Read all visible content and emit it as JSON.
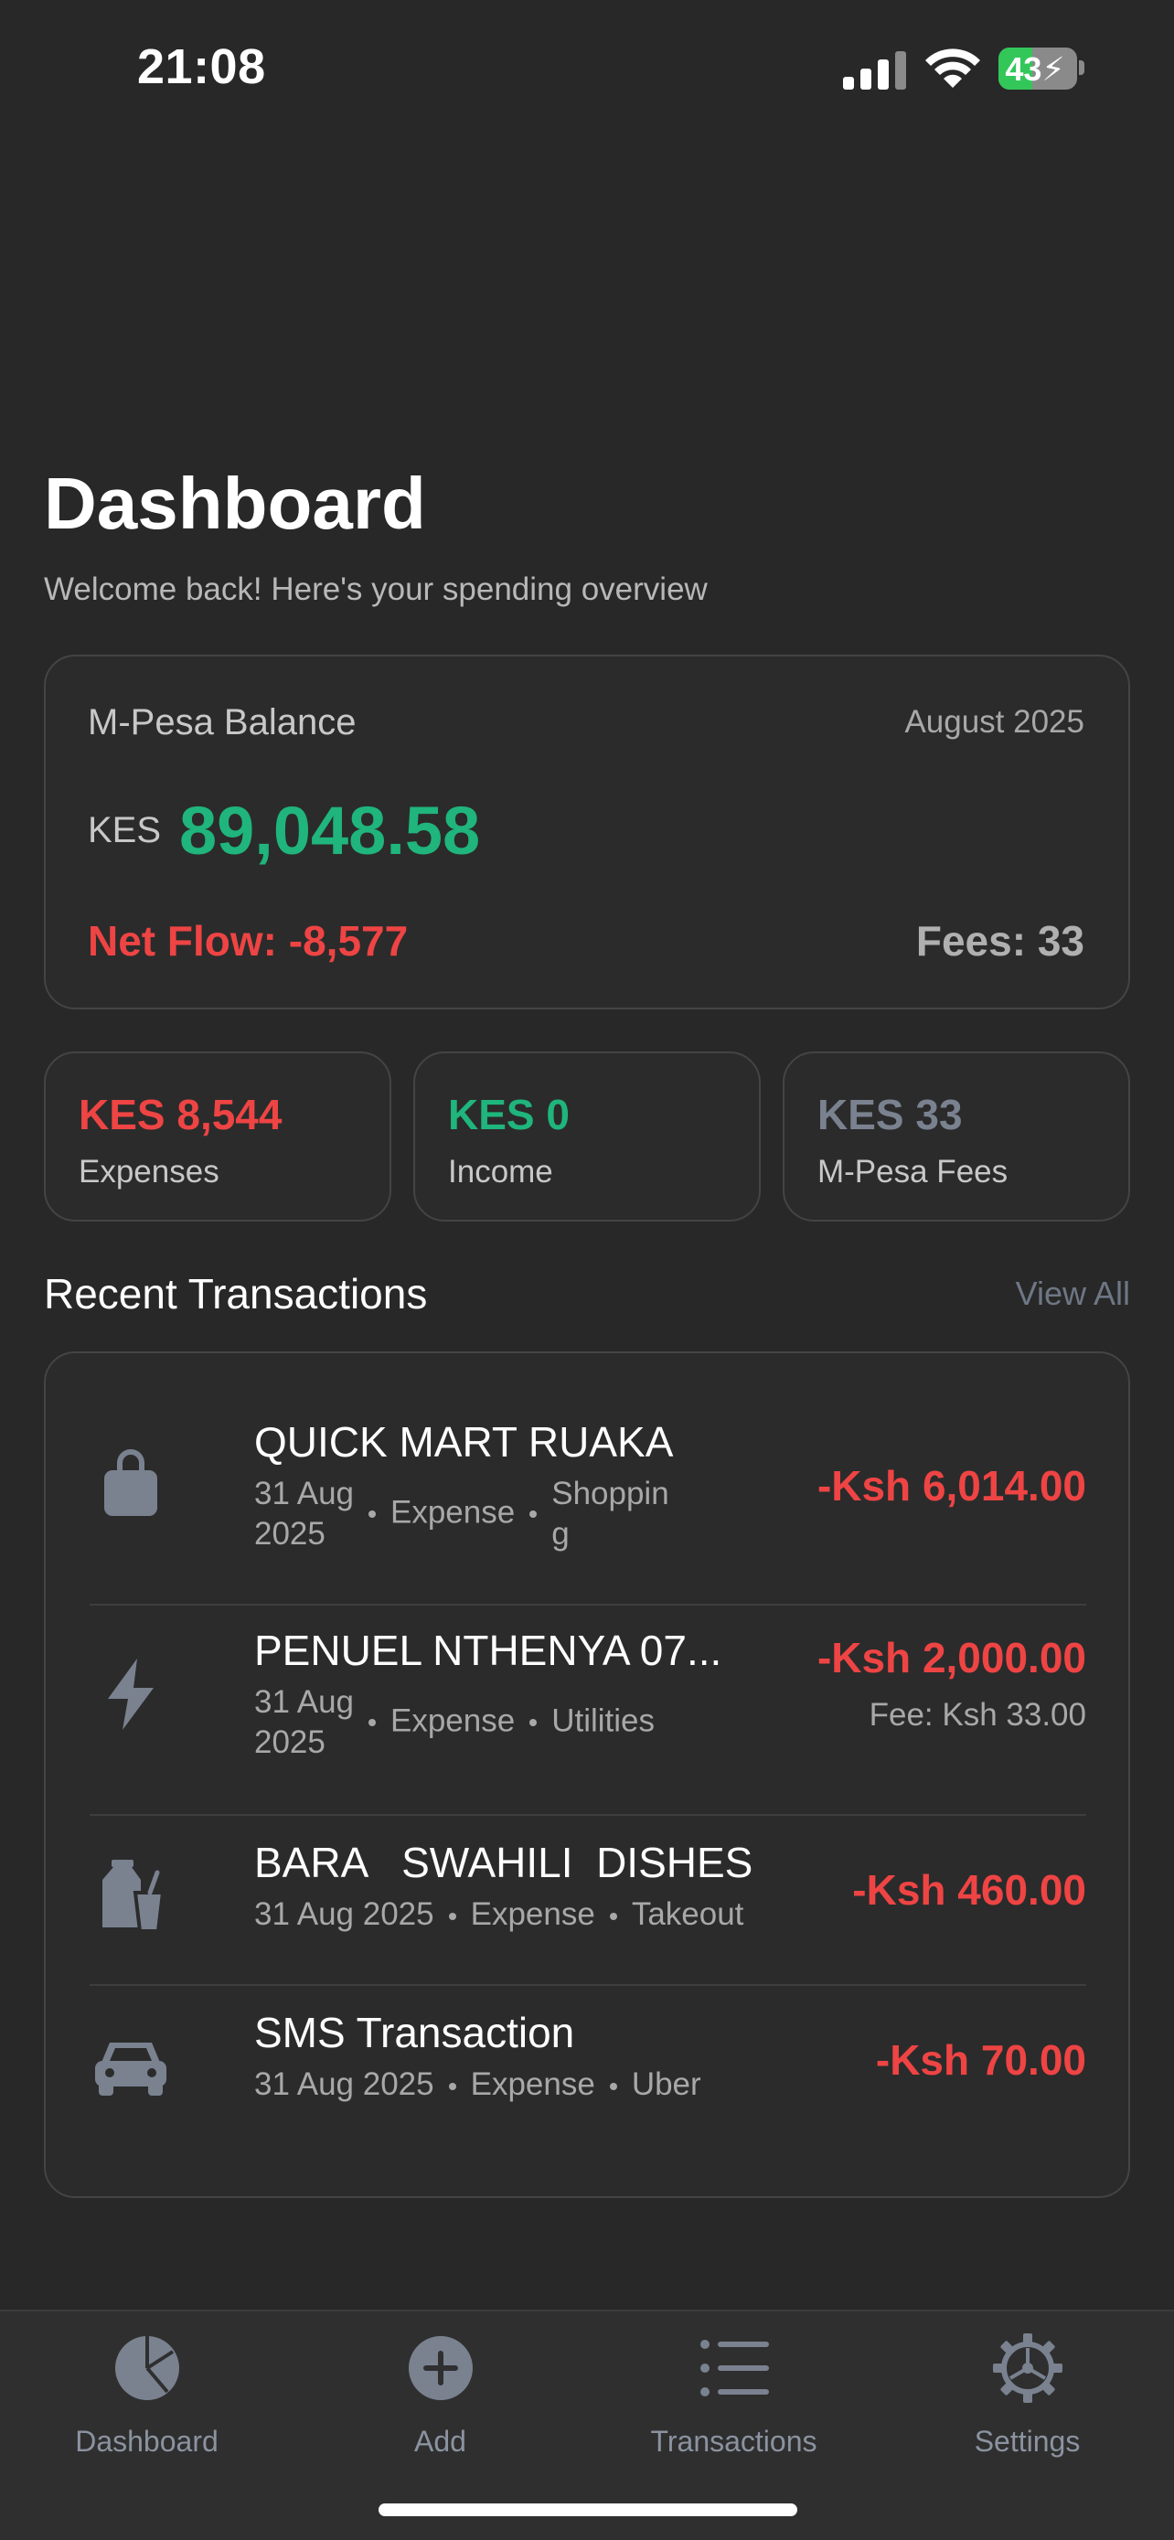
{
  "status_bar": {
    "time": "21:08",
    "battery": "43",
    "icons": [
      "signal-icon",
      "wifi-icon",
      "battery-charging-icon"
    ]
  },
  "header": {
    "title": "Dashboard",
    "subtitle": "Welcome back! Here's your spending overview"
  },
  "balance_card": {
    "label": "M-Pesa Balance",
    "period": "August 2025",
    "currency": "KES",
    "amount": "89,048.58",
    "net_flow": "Net Flow: -8,577",
    "fees": "Fees: 33",
    "colors": {
      "amount": "#1fb57c",
      "net_flow": "#ee4444"
    }
  },
  "stats": [
    {
      "value": "KES 8,544",
      "label": "Expenses",
      "color": "#ee4444"
    },
    {
      "value": "KES 0",
      "label": "Income",
      "color": "#1fb57c"
    },
    {
      "value": "KES 33",
      "label": "M-Pesa Fees",
      "color": "#7a8290"
    }
  ],
  "recent": {
    "title": "Recent Transactions",
    "view_all": "View All",
    "transactions": [
      {
        "name": "QUICK MART RUAKA",
        "date_line1": "31 Aug",
        "date_line2": "2025",
        "type": "Expense",
        "category_line1": "Shoppin",
        "category_line2": "g",
        "amount": "-Ksh 6,014.00",
        "icon": "shopping-bag-icon"
      },
      {
        "name": "PENUEL  NTHENYA 07...",
        "date_line1": "31 Aug",
        "date_line2": "2025",
        "type": "Expense",
        "category": "Utilities",
        "amount": "-Ksh 2,000.00",
        "fee": "Fee: Ksh 33.00",
        "icon": "lightning-bolt-icon"
      },
      {
        "name": "BARA   SWAHILI  DISHES",
        "date": "31 Aug 2025",
        "type": "Expense",
        "category": "Takeout",
        "amount": "-Ksh 460.00",
        "icon": "takeout-bag-icon"
      },
      {
        "name": "SMS Transaction",
        "date": "31 Aug 2025",
        "type": "Expense",
        "category": "Uber",
        "amount": "-Ksh 70.00",
        "icon": "car-icon"
      }
    ]
  },
  "tabs": [
    {
      "label": "Dashboard",
      "icon": "pie-chart-icon"
    },
    {
      "label": "Add",
      "icon": "plus-circle-icon"
    },
    {
      "label": "Transactions",
      "icon": "list-icon"
    },
    {
      "label": "Settings",
      "icon": "gear-icon"
    }
  ]
}
